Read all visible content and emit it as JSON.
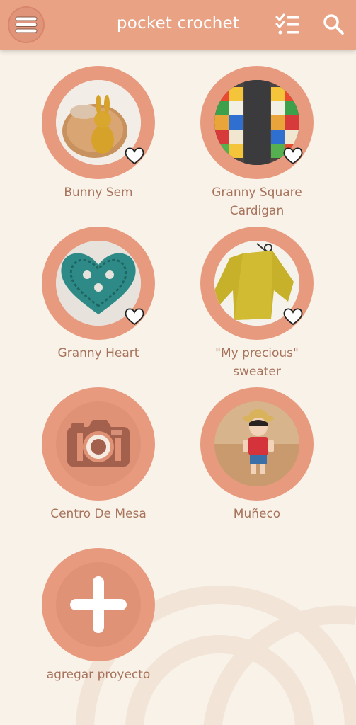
{
  "header": {
    "title": "pocket crochet",
    "icons": [
      "menu-icon",
      "checklist-icon",
      "search-icon"
    ]
  },
  "projects": [
    {
      "name": "Bunny Sem",
      "favorite": true
    },
    {
      "name": "Granny Square Cardigan",
      "favorite": true
    },
    {
      "name": "Granny Heart",
      "favorite": true
    },
    {
      "name": "\"My precious\" sweater",
      "favorite": true
    },
    {
      "name": "Centro De Mesa",
      "favorite": false
    },
    {
      "name": "Muñeco",
      "favorite": false
    }
  ],
  "add_project": {
    "label": "agregar proyecto"
  },
  "colors": {
    "header": "#e9a384",
    "background": "#f9f2e8",
    "circle": "#e89a7f",
    "label": "#a7735c"
  }
}
